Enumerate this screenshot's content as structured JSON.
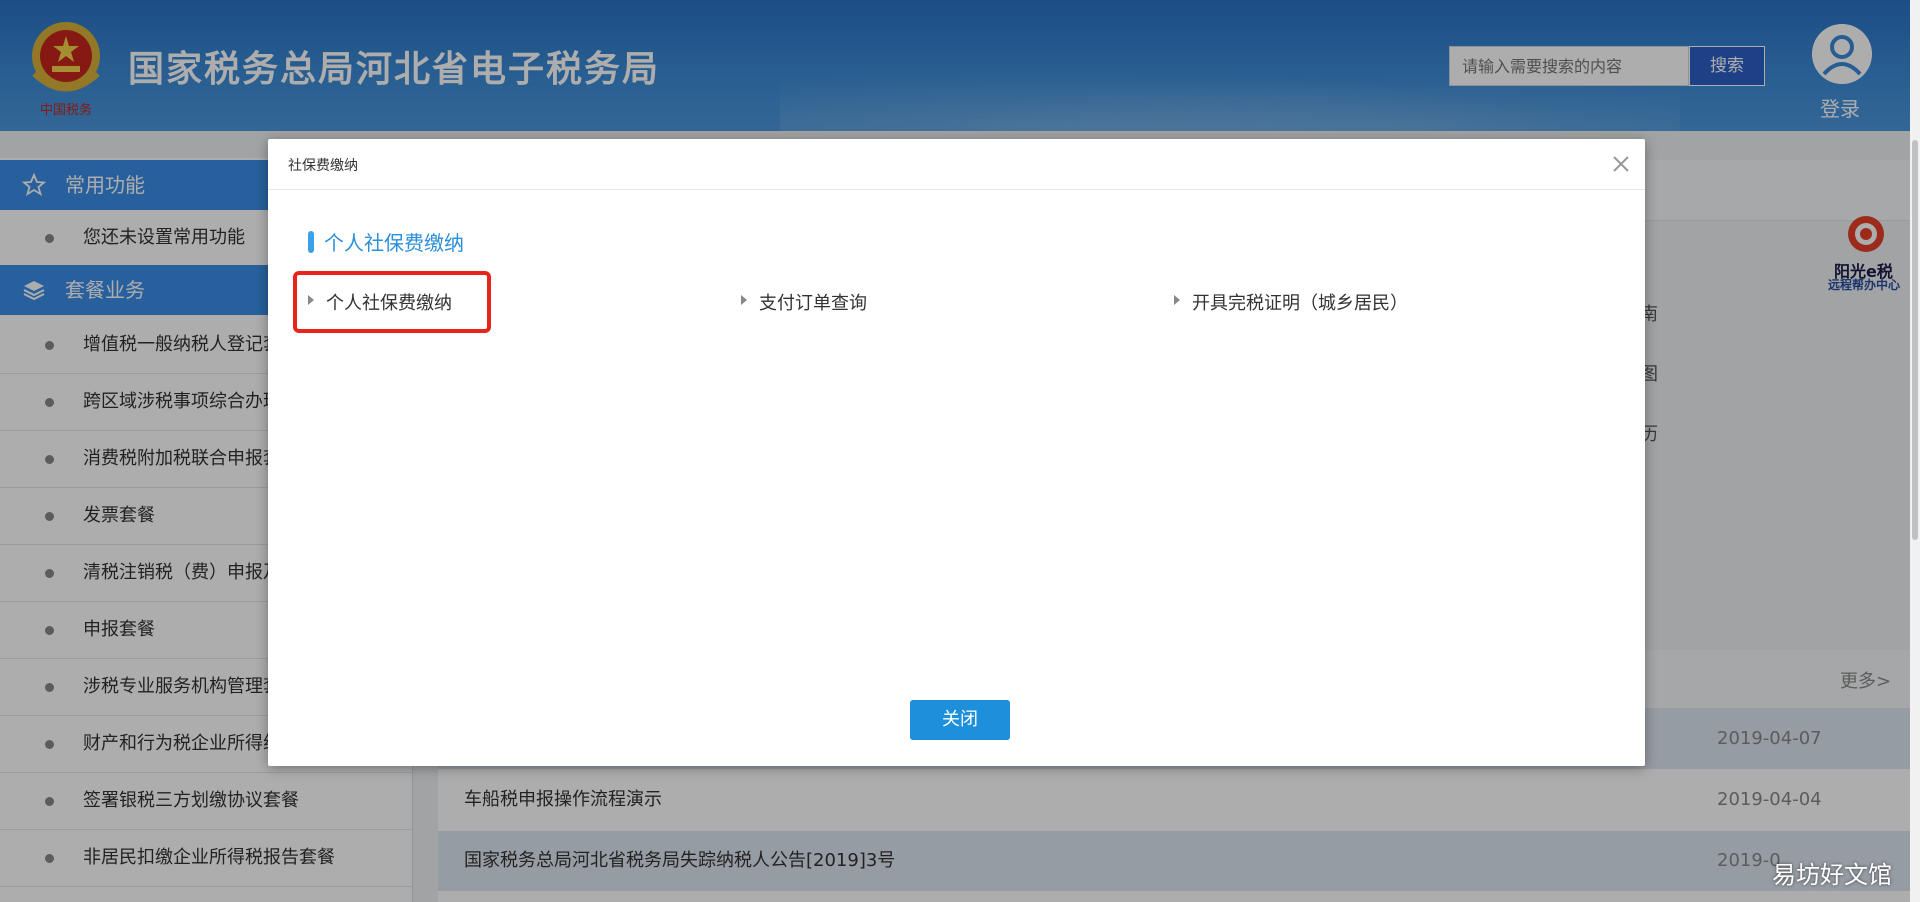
{
  "header": {
    "site_title": "国家税务总局河北省电子税务局",
    "emblem_caption": "中国税务",
    "search_placeholder": "请输入需要搜索的内容",
    "search_button": "搜索",
    "login_label": "登录"
  },
  "sidebar": {
    "common_head": "常用功能",
    "common_empty": "您还未设置常用功能",
    "package_head": "套餐业务",
    "items": [
      "增值税一般纳税人登记套",
      "跨区域涉税事项综合办理",
      "消费税附加税联合申报套",
      "发票套餐",
      "清税注销税（费）申报及",
      "申报套餐",
      "涉税专业服务机构管理套",
      "财产和行为税企业所得组",
      "签署银税三方划缴协议套餐",
      "非居民扣缴企业所得税报告套餐"
    ]
  },
  "background": {
    "guide_fragments": [
      "南",
      "图",
      "历"
    ],
    "sunshine_title": "阳光e税",
    "sunshine_subtitle": "远程帮办中心",
    "more_link": "更多>",
    "news": [
      {
        "title": "",
        "date": "2019-04-07"
      },
      {
        "title": "车船税申报操作流程演示",
        "date": "2019-04-04"
      },
      {
        "title": "国家税务总局河北省税务局失踪纳税人公告[2019]3号",
        "date": "2019-0"
      }
    ]
  },
  "modal": {
    "title": "社保费缴纳",
    "section_title": "个人社保费缴纳",
    "links": [
      "个人社保费缴纳",
      "支付订单查询",
      "开具完税证明（城乡居民）"
    ],
    "close_button": "关闭"
  },
  "watermark": "易坊好文馆",
  "colors": {
    "header_blue": "#3b8ad6",
    "sidebar_head_blue": "#3a8ee6",
    "accent_blue": "#2b8fd9",
    "highlight_red": "#e8231c"
  }
}
